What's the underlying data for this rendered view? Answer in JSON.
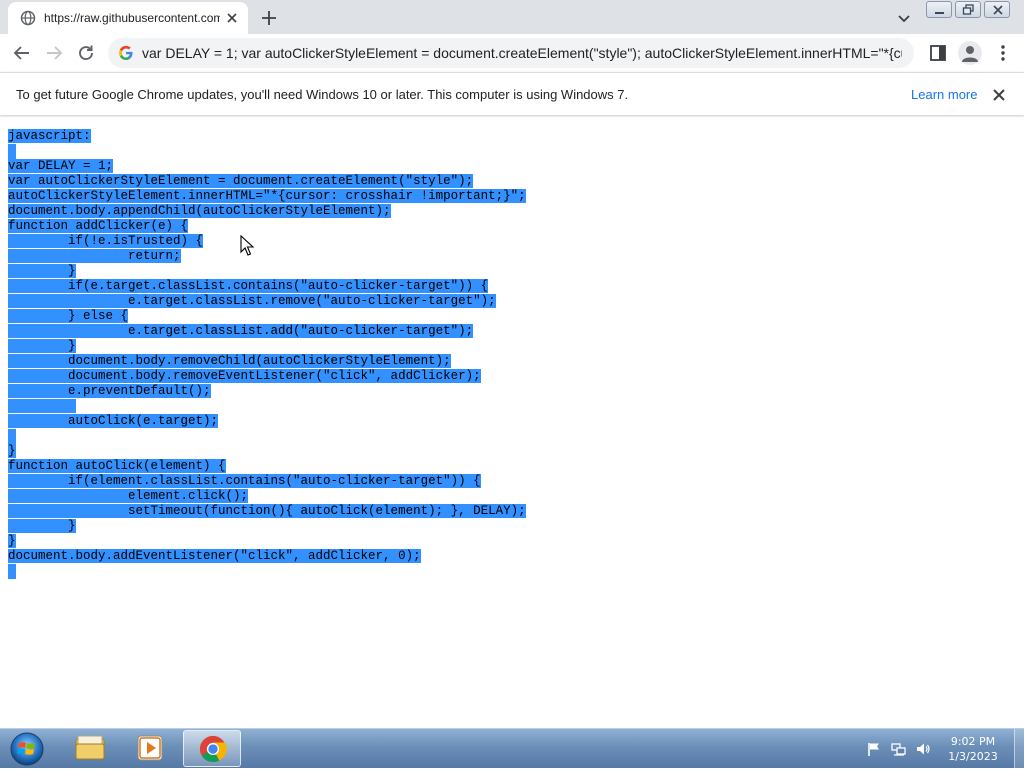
{
  "browser": {
    "tab": {
      "title": "https://raw.githubusercontent.com/",
      "favicon": "globe-icon"
    },
    "url": "var DELAY = 1; var autoClickerStyleElement = document.createElement(\"style\"); autoClickerStyleElement.innerHTML=\"*{cu...",
    "infobar": {
      "message": "To get future Google Chrome updates, you'll need Windows 10 or later. This computer is using Windows 7.",
      "link": "Learn more"
    }
  },
  "page": {
    "code_lines": [
      "javascript:",
      "",
      "var DELAY = 1;",
      "var autoClickerStyleElement = document.createElement(\"style\");",
      "autoClickerStyleElement.innerHTML=\"*{cursor: crosshair !important;}\";",
      "document.body.appendChild(autoClickerStyleElement);",
      "function addClicker(e) {",
      "        if(!e.isTrusted) {",
      "                return;",
      "        }",
      "        if(e.target.classList.contains(\"auto-clicker-target\")) {",
      "                e.target.classList.remove(\"auto-clicker-target\");",
      "        } else {",
      "                e.target.classList.add(\"auto-clicker-target\");",
      "        }",
      "        document.body.removeChild(autoClickerStyleElement);",
      "        document.body.removeEventListener(\"click\", addClicker);",
      "        e.preventDefault();",
      "         ",
      "        autoClick(e.target);",
      "",
      "}",
      "function autoClick(element) {",
      "        if(element.classList.contains(\"auto-clicker-target\")) {",
      "                element.click();",
      "                setTimeout(function(){ autoClick(element); }, DELAY);",
      "        }",
      "}",
      "document.body.addEventListener(\"click\", addClicker, 0);",
      ""
    ],
    "selection_color": "#3390ff"
  },
  "taskbar": {
    "time": "9:02 PM",
    "date": "1/3/2023",
    "pinned": [
      "file-explorer-icon",
      "media-player-icon",
      "chrome-icon"
    ],
    "tray": [
      "action-center-flag-icon",
      "network-icon",
      "volume-icon"
    ]
  },
  "colors": {
    "tabstrip": "#dee1e6",
    "omnibox": "#f1f3f4",
    "link": "#1a73e8",
    "selection": "#3390ff"
  }
}
